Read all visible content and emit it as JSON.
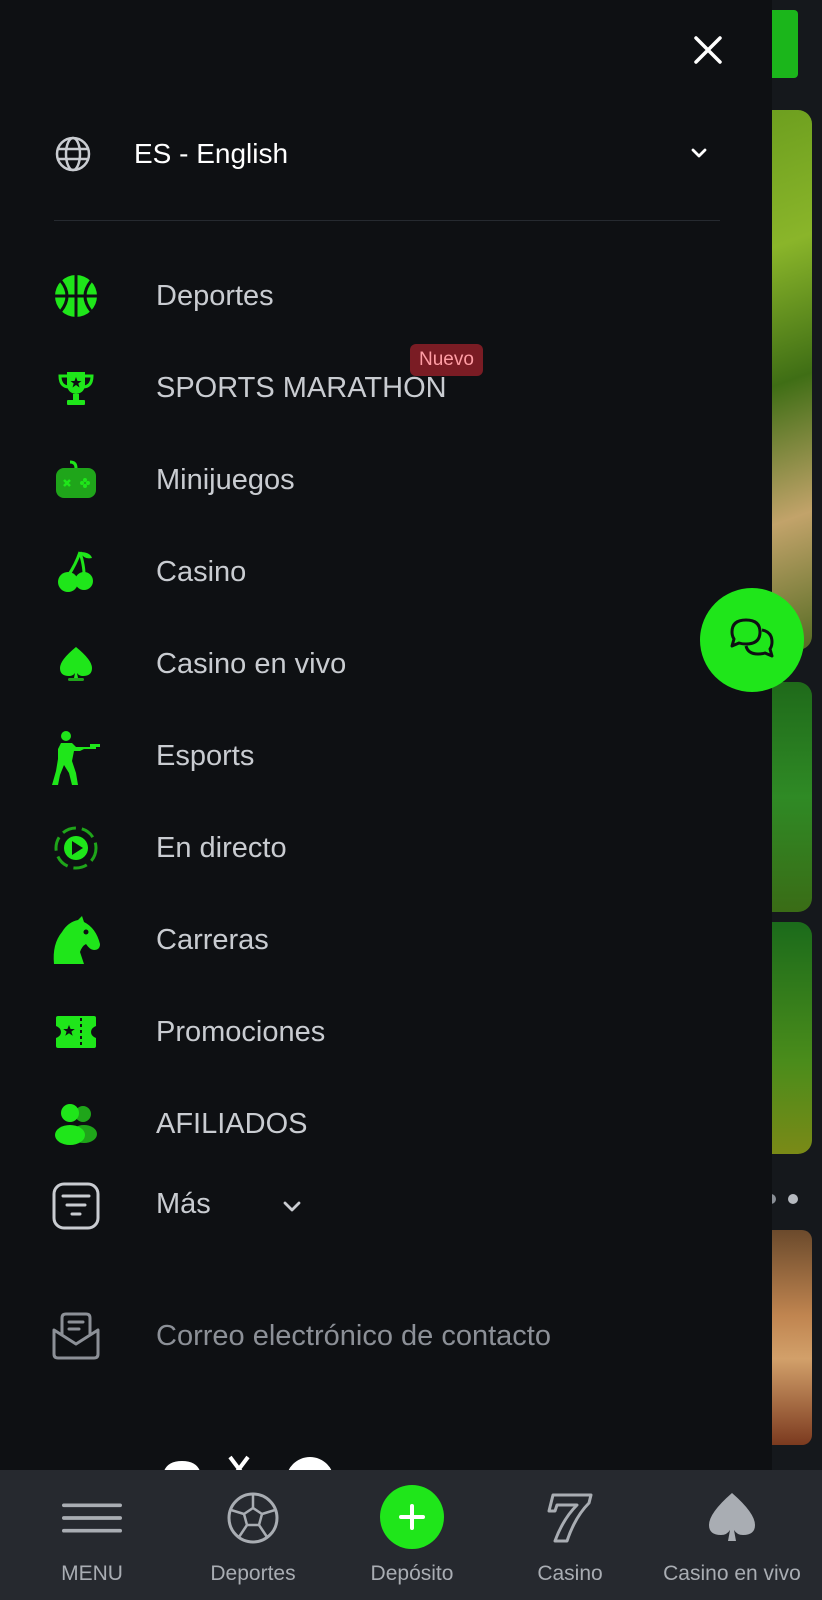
{
  "language": {
    "label": "ES - English"
  },
  "badge": {
    "new": "Nuevo"
  },
  "menu": {
    "items": [
      {
        "label": "Deportes",
        "icon": "basketball-icon"
      },
      {
        "label": "SPORTS MARATHON",
        "icon": "trophy-icon"
      },
      {
        "label": "Minijuegos",
        "icon": "gamepad-icon"
      },
      {
        "label": "Casino",
        "icon": "cherries-icon"
      },
      {
        "label": "Casino en vivo",
        "icon": "spade-icon"
      },
      {
        "label": "Esports",
        "icon": "soldier-icon"
      },
      {
        "label": "En directo",
        "icon": "play-circle-icon"
      },
      {
        "label": "Carreras",
        "icon": "horse-icon"
      },
      {
        "label": "Promociones",
        "icon": "ticket-icon"
      },
      {
        "label": "AFILIADOS",
        "icon": "users-icon"
      }
    ],
    "more": {
      "label": "Más"
    },
    "contact": {
      "label": "Correo electrónico de contacto"
    }
  },
  "bottom_nav": {
    "items": [
      {
        "label": "MENU",
        "icon": "hamburger-icon"
      },
      {
        "label": "Deportes",
        "icon": "soccer-ball-icon"
      },
      {
        "label": "Depósito",
        "icon": "plus-icon"
      },
      {
        "label": "Casino",
        "icon": "seven-icon"
      },
      {
        "label": "Casino en vivo",
        "icon": "spade-icon"
      }
    ]
  },
  "colors": {
    "accent": "#1fe61a",
    "background": "#0e1013",
    "nav_bg": "#26292f",
    "badge_bg": "#7a1c24"
  }
}
